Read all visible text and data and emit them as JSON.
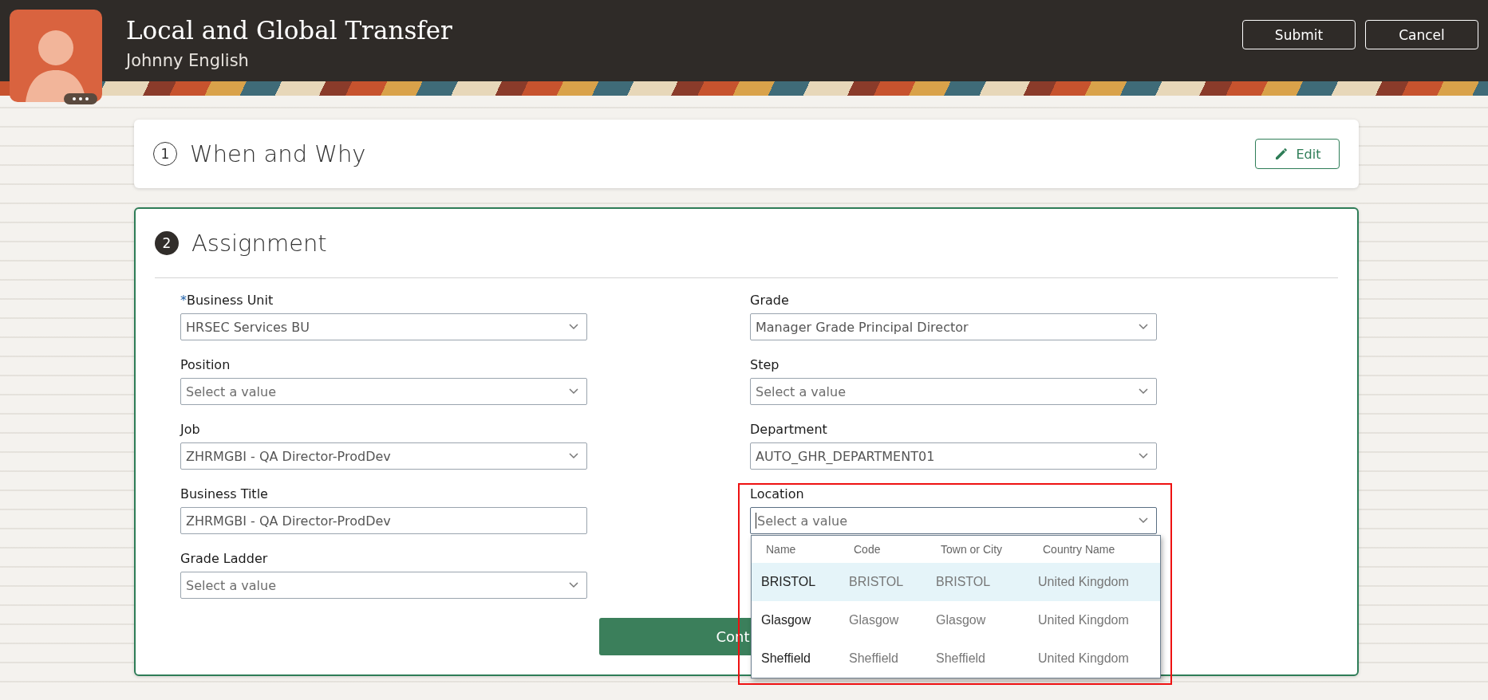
{
  "header": {
    "title": "Local and Global Transfer",
    "subtitle": "Johnny English",
    "actions": [
      {
        "label": "Submit"
      },
      {
        "label": "Cancel"
      }
    ]
  },
  "sections": [
    {
      "number": "1",
      "title": "When and Why",
      "kind": "complete",
      "action": "Edit"
    },
    {
      "number": "2",
      "title": "Assignment",
      "kind": "active",
      "columns": [
        [
          {
            "label": "Business Unit",
            "required_mark": "*",
            "kind": "select",
            "value": "HRSEC Services BU"
          },
          {
            "label": "Position",
            "kind": "select",
            "placeholder": "Select a value"
          },
          {
            "label": "Job",
            "kind": "select",
            "value": "ZHRMGBI - QA Director-ProdDev"
          },
          {
            "label": "Business Title",
            "kind": "text",
            "value": "ZHRMGBI - QA Director-ProdDev"
          },
          {
            "label": "Grade Ladder",
            "kind": "select",
            "placeholder": "Select a value"
          }
        ],
        [
          {
            "label": "Grade",
            "kind": "select",
            "value": "Manager Grade Principal Director"
          },
          {
            "label": "Step",
            "kind": "select",
            "placeholder": "Select a value"
          },
          {
            "label": "Department",
            "kind": "select",
            "value": "AUTO_GHR_DEPARTMENT01"
          },
          {
            "label": "Location",
            "kind": "select",
            "placeholder": "Select a value",
            "focused": true,
            "lookup": {
              "columns": [
                "Name",
                "Code",
                "Town or City",
                "Country Name"
              ],
              "rows": [
                {
                  "cells": [
                    "BRISTOL",
                    "BRISTOL",
                    "BRISTOL",
                    "United Kingdom"
                  ],
                  "selected": true
                },
                {
                  "cells": [
                    "Glasgow",
                    "Glasgow",
                    "Glasgow",
                    "United Kingdom"
                  ],
                  "selected": false
                },
                {
                  "cells": [
                    "Sheffield",
                    "Sheffield",
                    "Sheffield",
                    "United Kingdom"
                  ],
                  "selected": false
                }
              ]
            }
          }
        ]
      ],
      "continue_button": "Cont"
    }
  ]
}
